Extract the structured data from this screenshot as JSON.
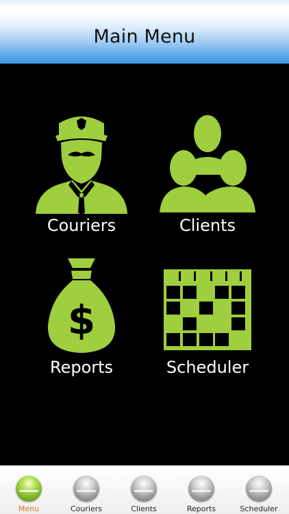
{
  "header": {
    "title": "Main Menu"
  },
  "tiles": [
    {
      "label": "Couriers",
      "icon": "courier-icon"
    },
    {
      "label": "Clients",
      "icon": "clients-icon"
    },
    {
      "label": "Reports",
      "icon": "money-bag-icon"
    },
    {
      "label": "Scheduler",
      "icon": "calendar-grid-icon"
    }
  ],
  "tabbar": {
    "items": [
      {
        "label": "Menu",
        "active": true
      },
      {
        "label": "Couriers",
        "active": false
      },
      {
        "label": "Clients",
        "active": false
      },
      {
        "label": "Reports",
        "active": false
      },
      {
        "label": "Scheduler",
        "active": false
      }
    ]
  },
  "colors": {
    "icon_green": "#9fce3e",
    "active_tab_label": "#d9771a",
    "header_blue": "#3f95e2"
  }
}
